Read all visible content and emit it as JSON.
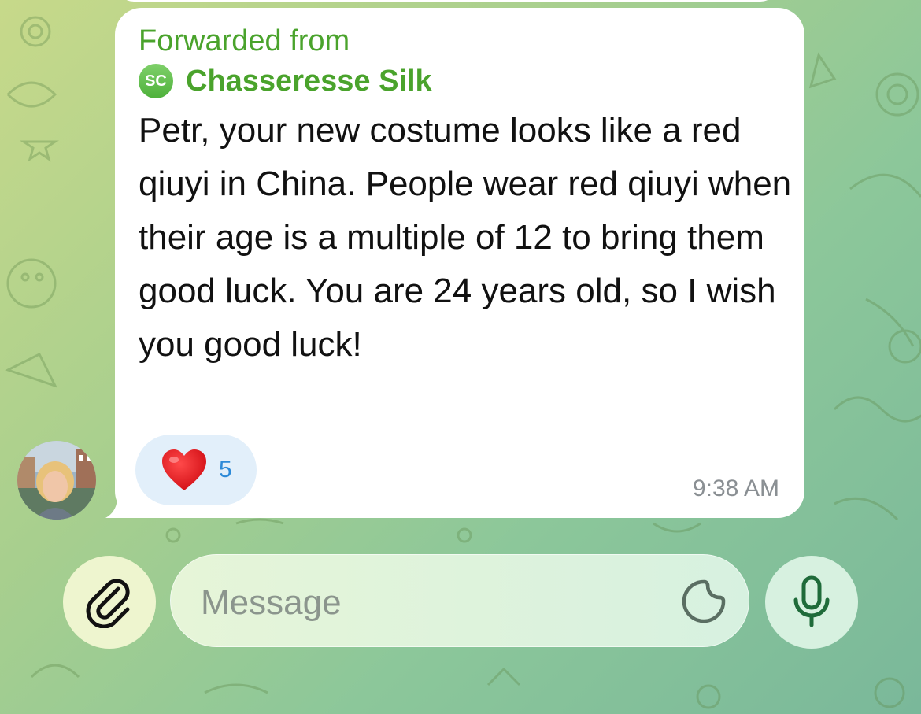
{
  "message": {
    "forwarded_label": "Forwarded from",
    "forwarded_from": {
      "initials": "SC",
      "name": "Chasseresse Silk"
    },
    "text": "Petr, your new costume looks like a red qiuyi in China. People wear red qiuyi when their age is a multiple of 12 to bring them good luck. You are 24 years old, so I wish you good luck!",
    "reaction": {
      "emoji": "heart",
      "count": "5"
    },
    "time": "9:38 AM"
  },
  "composer": {
    "placeholder": "Message",
    "attach_icon": "paperclip-icon",
    "sticker_icon": "sticker-icon",
    "mic_icon": "microphone-icon"
  },
  "colors": {
    "accent_green": "#4aa32c",
    "reaction_count_blue": "#2d8ad8",
    "bubble": "#ffffff"
  }
}
